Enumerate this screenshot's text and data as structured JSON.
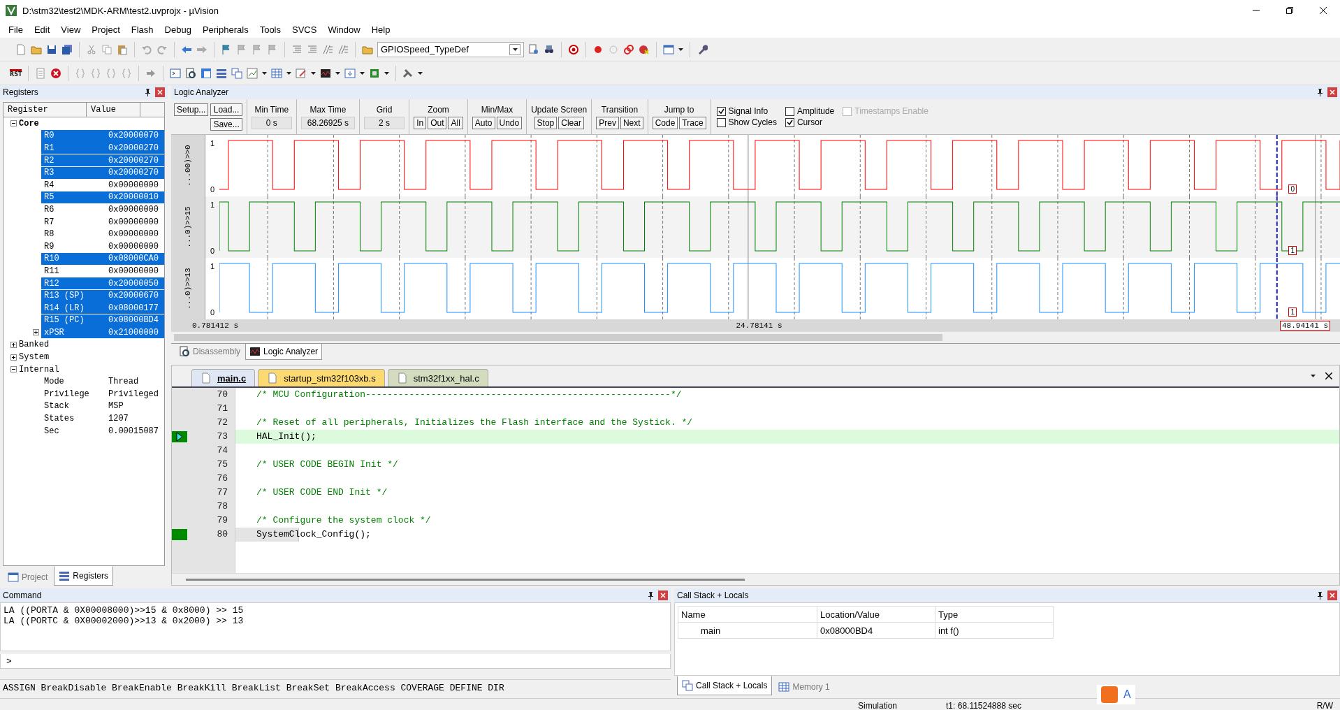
{
  "window": {
    "title": "D:\\stm32\\test2\\MDK-ARM\\test2.uvprojx - µVision"
  },
  "menu": [
    "File",
    "Edit",
    "View",
    "Project",
    "Flash",
    "Debug",
    "Peripherals",
    "Tools",
    "SVCS",
    "Window",
    "Help"
  ],
  "toolbar": {
    "find_combo": "GPIOSpeed_TypeDef",
    "reset_label": "RST"
  },
  "registers_panel": {
    "title": "Registers",
    "columns": [
      "Register",
      "Value"
    ],
    "tree": [
      {
        "name": "Core",
        "expanded": true,
        "children": [
          {
            "name": "R0",
            "value": "0x20000070",
            "selected": true
          },
          {
            "name": "R1",
            "value": "0x20000270",
            "selected": true
          },
          {
            "name": "R2",
            "value": "0x20000270",
            "selected": true
          },
          {
            "name": "R3",
            "value": "0x20000270",
            "selected": true
          },
          {
            "name": "R4",
            "value": "0x00000000",
            "selected": false
          },
          {
            "name": "R5",
            "value": "0x20000010",
            "selected": true
          },
          {
            "name": "R6",
            "value": "0x00000000",
            "selected": false
          },
          {
            "name": "R7",
            "value": "0x00000000",
            "selected": false
          },
          {
            "name": "R8",
            "value": "0x00000000",
            "selected": false
          },
          {
            "name": "R9",
            "value": "0x00000000",
            "selected": false
          },
          {
            "name": "R10",
            "value": "0x08000CA0",
            "selected": true
          },
          {
            "name": "R11",
            "value": "0x00000000",
            "selected": false
          },
          {
            "name": "R12",
            "value": "0x20000050",
            "selected": true
          },
          {
            "name": "R13 (SP)",
            "value": "0x20000670",
            "selected": true
          },
          {
            "name": "R14 (LR)",
            "value": "0x08000177",
            "selected": true
          },
          {
            "name": "R15 (PC)",
            "value": "0x08000BD4",
            "selected": true
          },
          {
            "name": "xPSR",
            "value": "0x21000000",
            "selected": true,
            "expanded": false
          }
        ]
      },
      {
        "name": "Banked",
        "expanded": false
      },
      {
        "name": "System",
        "expanded": false
      },
      {
        "name": "Internal",
        "expanded": true,
        "children": [
          {
            "name": "Mode",
            "value": "Thread",
            "selected": false
          },
          {
            "name": "Privilege",
            "value": "Privileged",
            "selected": false
          },
          {
            "name": "Stack",
            "value": "MSP",
            "selected": false
          },
          {
            "name": "States",
            "value": "1207",
            "selected": false
          },
          {
            "name": "Sec",
            "value": "0.00015087",
            "selected": false
          }
        ]
      }
    ],
    "tabs": [
      {
        "label": "Project",
        "selected": false
      },
      {
        "label": "Registers",
        "selected": true
      }
    ]
  },
  "logic_analyzer": {
    "title": "Logic Analyzer",
    "file_buttons": [
      "Setup...",
      "Load...",
      "Save..."
    ],
    "readouts": [
      {
        "label": "Min Time",
        "value": "0 s"
      },
      {
        "label": "Max Time",
        "value": "68.26925 s"
      },
      {
        "label": "Grid",
        "value": "2 s"
      }
    ],
    "button_groups": [
      {
        "label": "Zoom",
        "buttons": [
          "In",
          "Out",
          "All"
        ]
      },
      {
        "label": "Min/Max",
        "buttons": [
          "Auto",
          "Undo"
        ]
      },
      {
        "label": "Update Screen",
        "buttons": [
          "Stop",
          "Clear"
        ]
      },
      {
        "label": "Transition",
        "buttons": [
          "Prev",
          "Next"
        ]
      },
      {
        "label": "Jump to",
        "buttons": [
          "Code",
          "Trace"
        ]
      }
    ],
    "checkboxes": [
      {
        "label": "Signal Info",
        "checked": true,
        "disabled": false
      },
      {
        "label": "Amplitude",
        "checked": false,
        "disabled": false
      },
      {
        "label": "Timestamps Enable",
        "checked": false,
        "disabled": true
      },
      {
        "label": "Show Cycles",
        "checked": false,
        "disabled": false
      },
      {
        "label": "Cursor",
        "checked": true,
        "disabled": false
      }
    ],
    "signals": [
      {
        "name": "...00)>>0",
        "color": "#ff0000",
        "high": "1",
        "low": "0",
        "cursor_value": "0"
      },
      {
        "name": "...0)>>15",
        "color": "#008000",
        "high": "1",
        "low": "0",
        "cursor_value": "1"
      },
      {
        "name": "...0)>>13",
        "color": "#1e90ff",
        "high": "1",
        "low": "0",
        "cursor_value": "1"
      }
    ],
    "time_labels": [
      "0.781412 s",
      "24.78141 s",
      "48.94141 s"
    ]
  },
  "view_tabs": [
    {
      "label": "Disassembly",
      "selected": false
    },
    {
      "label": "Logic Analyzer",
      "selected": true
    }
  ],
  "editor": {
    "tabs": [
      {
        "label": "main.c",
        "selected": true,
        "color": "#dfe7f5"
      },
      {
        "label": "startup_stm32f103xb.s",
        "selected": false,
        "color": "#fcd971"
      },
      {
        "label": "stm32f1xx_hal.c",
        "selected": false,
        "color": "#d4dcbf"
      }
    ],
    "lines": [
      {
        "number": "70",
        "text": "/* MCU Configuration--------------------------------------------------------*/",
        "kind": "comment",
        "current": false,
        "marker": false
      },
      {
        "number": "71",
        "current": false,
        "marker": false
      },
      {
        "number": "72",
        "text": "/* Reset of all peripherals, Initializes the Flash interface and the Systick. */",
        "kind": "comment",
        "current": false,
        "marker": false
      },
      {
        "number": "73",
        "text": "HAL_Init();",
        "kind": "code",
        "current": true,
        "marker": true
      },
      {
        "number": "74",
        "current": false,
        "marker": false
      },
      {
        "number": "75",
        "text": "/* USER CODE BEGIN Init */",
        "kind": "comment",
        "current": false,
        "marker": false
      },
      {
        "number": "76",
        "current": false,
        "marker": false
      },
      {
        "number": "77",
        "text": "/* USER CODE END Init */",
        "kind": "comment",
        "current": false,
        "marker": false
      },
      {
        "number": "78",
        "current": false,
        "marker": false
      },
      {
        "number": "79",
        "text": "/* Configure the system clock */",
        "kind": "comment",
        "current": false,
        "marker": false
      },
      {
        "number": "80",
        "text": "SystemClock_Config();",
        "kind": "code",
        "current": false,
        "marker": true
      }
    ]
  },
  "command_panel": {
    "title": "Command",
    "output": [
      "LA ((PORTA & 0X00008000)>>15 & 0x8000) >> 15",
      "LA ((PORTC & 0X00002000)>>13 & 0x2000) >> 13"
    ],
    "prompt": ">",
    "help": "ASSIGN BreakDisable BreakEnable BreakKill BreakList BreakSet BreakAccess COVERAGE DEFINE DIR"
  },
  "callstack_panel": {
    "title": "Call Stack + Locals",
    "columns": [
      "Name",
      "Location/Value",
      "Type"
    ],
    "rows": [
      {
        "name": "main",
        "location": "0x08000BD4",
        "type": "int f()"
      }
    ],
    "tabs": [
      {
        "label": "Call Stack + Locals",
        "selected": true
      },
      {
        "label": "Memory 1",
        "selected": false
      }
    ]
  },
  "ime_bar": {
    "label": "A"
  },
  "status_bar": {
    "mode": "Simulation",
    "time": "t1: 68.11524888 sec",
    "access": "R/W"
  }
}
